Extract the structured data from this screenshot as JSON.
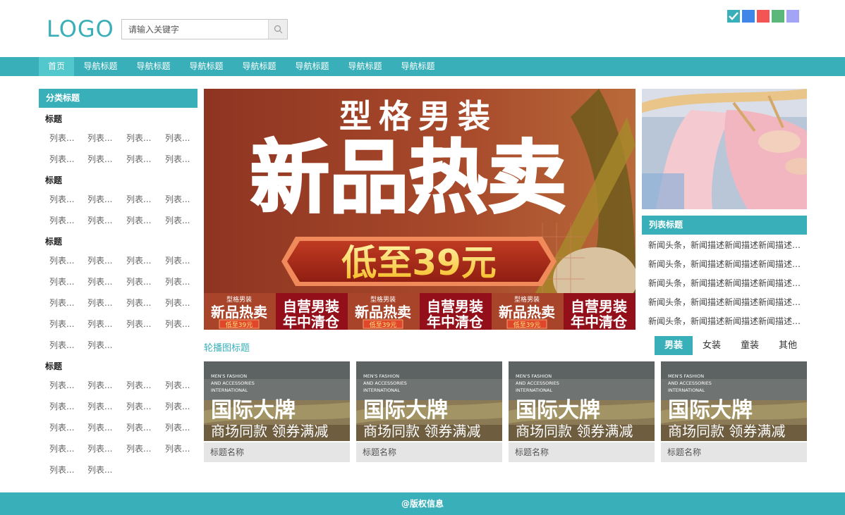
{
  "header": {
    "logo": "LOGO",
    "search_placeholder": "请输入关键字",
    "theme_colors": [
      "#39b0b9",
      "#3f86e8",
      "#f35555",
      "#5cb87a",
      "#a4a4f6"
    ],
    "search_icon": "search-icon",
    "check_icon": "check-icon"
  },
  "nav": {
    "items": [
      "首页",
      "导航标题",
      "导航标题",
      "导航标题",
      "导航标题",
      "导航标题",
      "导航标题",
      "导航标题"
    ],
    "active_index": 0
  },
  "sidebar": {
    "heading": "分类标题",
    "groups": [
      {
        "title": "标题",
        "rows": [
          [
            "列表...",
            "列表...",
            "列表...",
            "列表..."
          ],
          [
            "列表...",
            "列表...",
            "列表...",
            "列表..."
          ]
        ]
      },
      {
        "title": "标题",
        "rows": [
          [
            "列表...",
            "列表...",
            "列表...",
            "列表..."
          ],
          [
            "列表...",
            "列表...",
            "列表...",
            "列表..."
          ]
        ]
      },
      {
        "title": "标题",
        "rows": [
          [
            "列表...",
            "列表...",
            "列表...",
            "列表..."
          ],
          [
            "列表...",
            "列表...",
            "列表...",
            "列表..."
          ],
          [
            "列表...",
            "列表...",
            "列表...",
            "列表..."
          ],
          [
            "列表...",
            "列表...",
            "列表...",
            "列表..."
          ],
          [
            "列表...",
            "列表..."
          ]
        ]
      },
      {
        "title": "标题",
        "rows": [
          [
            "列表...",
            "列表...",
            "列表...",
            "列表..."
          ],
          [
            "列表...",
            "列表...",
            "列表...",
            "列表..."
          ],
          [
            "列表...",
            "列表...",
            "列表...",
            "列表..."
          ],
          [
            "列表...",
            "列表...",
            "列表...",
            "列表..."
          ],
          [
            "列表...",
            "列表..."
          ]
        ]
      }
    ]
  },
  "banner": {
    "line1": "型格男装",
    "line2": "新品热卖",
    "price": "低至39元",
    "strip_small": "型格男装",
    "strip_big": "新品热卖",
    "strip_price": "低至39元",
    "strip_side1": "自营男装",
    "strip_side2": "年中清仓"
  },
  "news_list": {
    "heading": "列表标题",
    "items": [
      "新闻头条，新闻描述新闻描述新闻描述新闻描述新闻描述",
      "新闻头条，新闻描述新闻描述新闻描述新闻描述新闻描述",
      "新闻头条，新闻描述新闻描述新闻描述新闻描述新闻描述",
      "新闻头条，新闻描述新闻描述新闻描述新闻描述新闻描述",
      "新闻头条，新闻描述新闻描述新闻描述新闻描述新闻描述"
    ]
  },
  "carousel": {
    "title": "轮播图标题",
    "tabs": [
      "男装",
      "女装",
      "童装",
      "其他"
    ],
    "active_tab": 0,
    "cards": [
      {
        "en1": "MEN'S FASHION",
        "en2": "AND ACCESSORIES",
        "en3": "INTERNATIONAL",
        "big": "国际大牌",
        "sub": "商场同款 领券满减",
        "name": "标题名称"
      },
      {
        "en1": "MEN'S FASHION",
        "en2": "AND ACCESSORIES",
        "en3": "INTERNATIONAL",
        "big": "国际大牌",
        "sub": "商场同款 领券满减",
        "name": "标题名称"
      },
      {
        "en1": "MEN'S FASHION",
        "en2": "AND ACCESSORIES",
        "en3": "INTERNATIONAL",
        "big": "国际大牌",
        "sub": "商场同款 领券满减",
        "name": "标题名称"
      },
      {
        "en1": "MEN'S FASHION",
        "en2": "AND ACCESSORIES",
        "en3": "INTERNATIONAL",
        "big": "国际大牌",
        "sub": "商场同款 领券满减",
        "name": "标题名称"
      }
    ]
  },
  "footer": {
    "copyright": "@版权信息"
  }
}
